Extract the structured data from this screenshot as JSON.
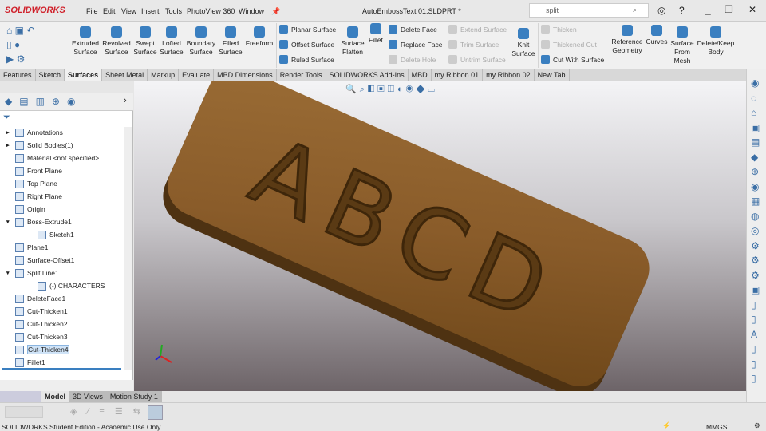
{
  "app": {
    "logo": "SOLIDWORKS",
    "title": "AutoEmbossText 01.SLDPRT *"
  },
  "menu": [
    "File",
    "Edit",
    "View",
    "Insert",
    "Tools",
    "PhotoView 360",
    "Window"
  ],
  "search": {
    "value": "split"
  },
  "ribbon": {
    "big": [
      "Extruded Surface",
      "Revolved Surface",
      "Swept Surface",
      "Lofted Surface",
      "Boundary Surface",
      "Filled Surface",
      "Freeform"
    ],
    "col1": [
      "Planar Surface",
      "Offset Surface",
      "Ruled Surface"
    ],
    "flatten": "Surface Flatten",
    "fillet": "Fillet",
    "col2": [
      "Delete Face",
      "Replace Face",
      "Delete Hole"
    ],
    "col3": [
      "Extend Surface",
      "Trim Surface",
      "Untrim Surface"
    ],
    "knit": "Knit Surface",
    "col4": [
      "Thicken",
      "Thickened Cut",
      "Cut With Surface"
    ],
    "ref": "Reference Geometry",
    "curves": "Curves",
    "mesh": "Surface From Mesh",
    "delkeep": "Delete/Keep Body"
  },
  "tabs": [
    "Features",
    "Sketch",
    "Surfaces",
    "Sheet Metal",
    "Markup",
    "Evaluate",
    "MBD Dimensions",
    "Render Tools",
    "SOLIDWORKS Add-Ins",
    "MBD",
    "my Ribbon 01",
    "my Ribbon 02",
    "New Tab"
  ],
  "active_tab": "Surfaces",
  "tree": [
    "Annotations",
    "Solid Bodies(1)",
    "Material <not specified>",
    "Front Plane",
    "Top Plane",
    "Right Plane",
    "Origin",
    "Boss-Extrude1",
    "Sketch1",
    "Plane1",
    "Surface-Offset1",
    "Split Line1",
    "(-) CHARACTERS",
    "DeleteFace1",
    "Cut-Thicken1",
    "Cut-Thicken2",
    "Cut-Thicken3",
    "Cut-Thicken4",
    "Fillet1"
  ],
  "selected_tree_item": "Cut-Thicken4",
  "model_text": "ABCD",
  "bottom_tabs": [
    "Model",
    "3D Views",
    "Motion Study 1"
  ],
  "status": {
    "text": "SOLIDWORKS Student Edition - Academic Use Only",
    "units": "MMGS"
  }
}
